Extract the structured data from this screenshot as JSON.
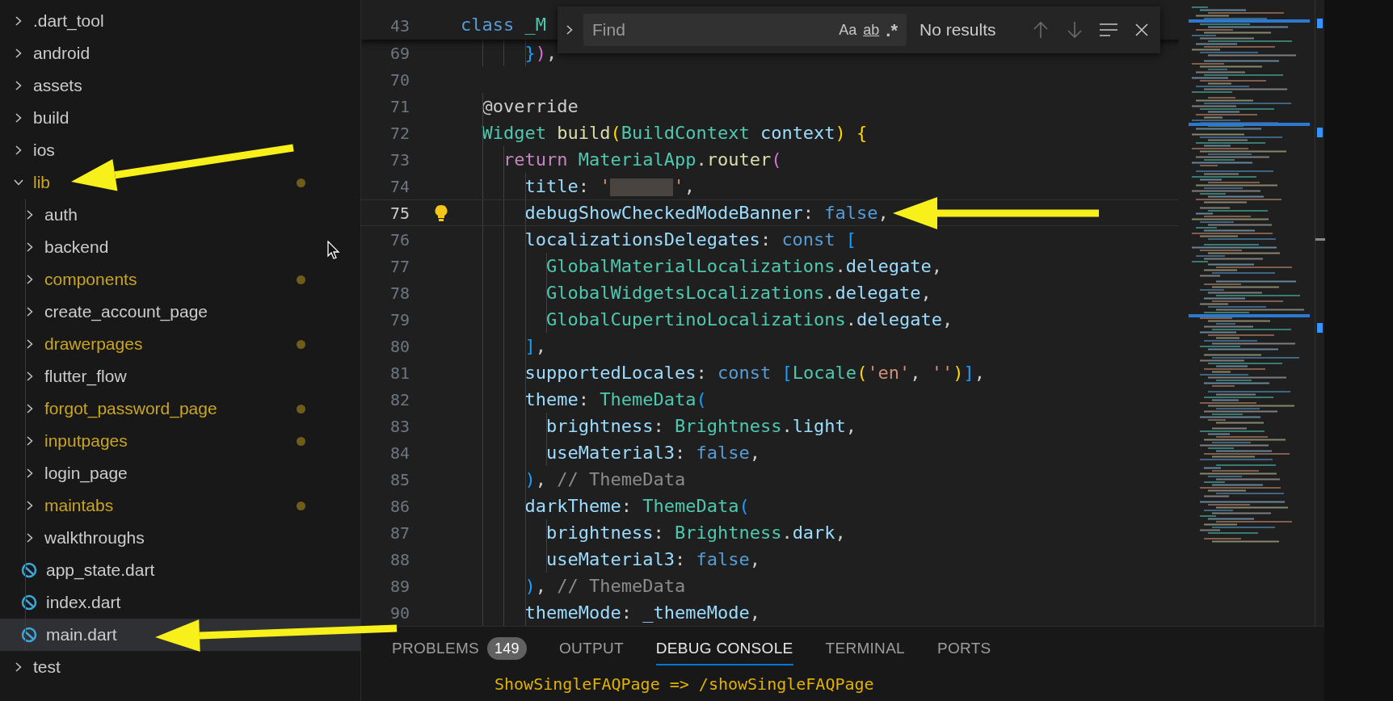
{
  "explorer": {
    "items": [
      {
        "label": ".dart_tool",
        "kind": "folder",
        "expanded": false,
        "modified": false,
        "selected": false
      },
      {
        "label": "android",
        "kind": "folder",
        "expanded": false,
        "modified": false,
        "selected": false
      },
      {
        "label": "assets",
        "kind": "folder",
        "expanded": false,
        "modified": false,
        "selected": false
      },
      {
        "label": "build",
        "kind": "folder",
        "expanded": false,
        "modified": false,
        "selected": false
      },
      {
        "label": "ios",
        "kind": "folder",
        "expanded": false,
        "modified": false,
        "selected": false
      },
      {
        "label": "lib",
        "kind": "folder",
        "expanded": true,
        "modified": true,
        "selected": false,
        "children": [
          {
            "label": "auth",
            "kind": "folder",
            "expanded": false,
            "modified": false,
            "selected": false
          },
          {
            "label": "backend",
            "kind": "folder",
            "expanded": false,
            "modified": false,
            "selected": false
          },
          {
            "label": "components",
            "kind": "folder",
            "expanded": false,
            "modified": true,
            "selected": false
          },
          {
            "label": "create_account_page",
            "kind": "folder",
            "expanded": false,
            "modified": false,
            "selected": false
          },
          {
            "label": "drawerpages",
            "kind": "folder",
            "expanded": false,
            "modified": true,
            "selected": false
          },
          {
            "label": "flutter_flow",
            "kind": "folder",
            "expanded": false,
            "modified": false,
            "selected": false
          },
          {
            "label": "forgot_password_page",
            "kind": "folder",
            "expanded": false,
            "modified": true,
            "selected": false
          },
          {
            "label": "inputpages",
            "kind": "folder",
            "expanded": false,
            "modified": true,
            "selected": false
          },
          {
            "label": "login_page",
            "kind": "folder",
            "expanded": false,
            "modified": false,
            "selected": false
          },
          {
            "label": "maintabs",
            "kind": "folder",
            "expanded": false,
            "modified": true,
            "selected": false
          },
          {
            "label": "walkthroughs",
            "kind": "folder",
            "expanded": false,
            "modified": false,
            "selected": false
          },
          {
            "label": "app_state.dart",
            "kind": "file",
            "modified": false,
            "selected": false
          },
          {
            "label": "index.dart",
            "kind": "file",
            "modified": false,
            "selected": false
          },
          {
            "label": "main.dart",
            "kind": "file",
            "modified": false,
            "selected": true
          }
        ]
      },
      {
        "label": "test",
        "kind": "folder",
        "expanded": false,
        "modified": false,
        "selected": false
      }
    ]
  },
  "editor": {
    "sticky_line": {
      "number": "43",
      "tokens": [
        {
          "kind": "kw",
          "text": "class "
        },
        {
          "kind": "type",
          "text": "_M"
        }
      ]
    },
    "lines": [
      {
        "number": "69",
        "current": false,
        "lightbulb": false,
        "tokens": [
          {
            "kind": "b3",
            "text": "      }"
          },
          {
            "kind": "b2",
            "text": ")"
          },
          {
            "kind": "plain",
            "text": ","
          }
        ]
      },
      {
        "number": "70",
        "current": false,
        "lightbulb": false
      },
      {
        "number": "71",
        "current": false,
        "lightbulb": false,
        "tokens": [
          {
            "kind": "plain",
            "text": "  @override"
          }
        ]
      },
      {
        "number": "72",
        "current": false,
        "lightbulb": false,
        "tokens": [
          {
            "kind": "type",
            "text": "  Widget "
          },
          {
            "kind": "fn",
            "text": "build"
          },
          {
            "kind": "b1",
            "text": "("
          },
          {
            "kind": "type",
            "text": "BuildContext "
          },
          {
            "kind": "prop",
            "text": "context"
          },
          {
            "kind": "b1",
            "text": ") "
          },
          {
            "kind": "b1",
            "text": "{"
          }
        ]
      },
      {
        "number": "73",
        "current": false,
        "lightbulb": false,
        "tokens": [
          {
            "kind": "ctl",
            "text": "    return "
          },
          {
            "kind": "type",
            "text": "MaterialApp"
          },
          {
            "kind": "plain",
            "text": "."
          },
          {
            "kind": "fn",
            "text": "router"
          },
          {
            "kind": "b2",
            "text": "("
          }
        ]
      },
      {
        "number": "74",
        "current": false,
        "lightbulb": false,
        "tokens": [
          {
            "kind": "prop",
            "text": "      title"
          },
          {
            "kind": "plain",
            "text": ": "
          },
          {
            "kind": "str",
            "text": "'"
          },
          {
            "kind": "redacted"
          },
          {
            "kind": "str",
            "text": "'"
          },
          {
            "kind": "plain",
            "text": ","
          }
        ]
      },
      {
        "number": "75",
        "current": true,
        "lightbulb": true,
        "tokens": [
          {
            "kind": "prop",
            "text": "      debugShowCheckedModeBanner"
          },
          {
            "kind": "plain",
            "text": ": "
          },
          {
            "kind": "kw",
            "text": "false"
          },
          {
            "kind": "plain",
            "text": ","
          }
        ]
      },
      {
        "number": "76",
        "current": false,
        "lightbulb": false,
        "tokens": [
          {
            "kind": "prop",
            "text": "      localizationsDelegates"
          },
          {
            "kind": "plain",
            "text": ": "
          },
          {
            "kind": "kw",
            "text": "const "
          },
          {
            "kind": "b3",
            "text": "["
          }
        ]
      },
      {
        "number": "77",
        "current": false,
        "lightbulb": false,
        "tokens": [
          {
            "kind": "type",
            "text": "        GlobalMaterialLocalizations"
          },
          {
            "kind": "plain",
            "text": "."
          },
          {
            "kind": "prop",
            "text": "delegate"
          },
          {
            "kind": "plain",
            "text": ","
          }
        ]
      },
      {
        "number": "78",
        "current": false,
        "lightbulb": false,
        "tokens": [
          {
            "kind": "type",
            "text": "        GlobalWidgetsLocalizations"
          },
          {
            "kind": "plain",
            "text": "."
          },
          {
            "kind": "prop",
            "text": "delegate"
          },
          {
            "kind": "plain",
            "text": ","
          }
        ]
      },
      {
        "number": "79",
        "current": false,
        "lightbulb": false,
        "tokens": [
          {
            "kind": "type",
            "text": "        GlobalCupertinoLocalizations"
          },
          {
            "kind": "plain",
            "text": "."
          },
          {
            "kind": "prop",
            "text": "delegate"
          },
          {
            "kind": "plain",
            "text": ","
          }
        ]
      },
      {
        "number": "80",
        "current": false,
        "lightbulb": false,
        "tokens": [
          {
            "kind": "b3",
            "text": "      ]"
          },
          {
            "kind": "plain",
            "text": ","
          }
        ]
      },
      {
        "number": "81",
        "current": false,
        "lightbulb": false,
        "tokens": [
          {
            "kind": "prop",
            "text": "      supportedLocales"
          },
          {
            "kind": "plain",
            "text": ": "
          },
          {
            "kind": "kw",
            "text": "const "
          },
          {
            "kind": "b3",
            "text": "["
          },
          {
            "kind": "type",
            "text": "Locale"
          },
          {
            "kind": "b1",
            "text": "("
          },
          {
            "kind": "str",
            "text": "'en'"
          },
          {
            "kind": "plain",
            "text": ", "
          },
          {
            "kind": "str",
            "text": "''"
          },
          {
            "kind": "b1",
            "text": ")"
          },
          {
            "kind": "b3",
            "text": "]"
          },
          {
            "kind": "plain",
            "text": ","
          }
        ]
      },
      {
        "number": "82",
        "current": false,
        "lightbulb": false,
        "tokens": [
          {
            "kind": "prop",
            "text": "      theme"
          },
          {
            "kind": "plain",
            "text": ": "
          },
          {
            "kind": "type",
            "text": "ThemeData"
          },
          {
            "kind": "b3",
            "text": "("
          }
        ]
      },
      {
        "number": "83",
        "current": false,
        "lightbulb": false,
        "tokens": [
          {
            "kind": "prop",
            "text": "        brightness"
          },
          {
            "kind": "plain",
            "text": ": "
          },
          {
            "kind": "type",
            "text": "Brightness"
          },
          {
            "kind": "plain",
            "text": "."
          },
          {
            "kind": "prop",
            "text": "light"
          },
          {
            "kind": "plain",
            "text": ","
          }
        ]
      },
      {
        "number": "84",
        "current": false,
        "lightbulb": false,
        "tokens": [
          {
            "kind": "prop",
            "text": "        useMaterial3"
          },
          {
            "kind": "plain",
            "text": ": "
          },
          {
            "kind": "kw",
            "text": "false"
          },
          {
            "kind": "plain",
            "text": ","
          }
        ]
      },
      {
        "number": "85",
        "current": false,
        "lightbulb": false,
        "tokens": [
          {
            "kind": "b3",
            "text": "      )"
          },
          {
            "kind": "plain",
            "text": ", "
          },
          {
            "kind": "cmt",
            "text": "// ThemeData"
          }
        ]
      },
      {
        "number": "86",
        "current": false,
        "lightbulb": false,
        "tokens": [
          {
            "kind": "prop",
            "text": "      darkTheme"
          },
          {
            "kind": "plain",
            "text": ": "
          },
          {
            "kind": "type",
            "text": "ThemeData"
          },
          {
            "kind": "b3",
            "text": "("
          }
        ]
      },
      {
        "number": "87",
        "current": false,
        "lightbulb": false,
        "tokens": [
          {
            "kind": "prop",
            "text": "        brightness"
          },
          {
            "kind": "plain",
            "text": ": "
          },
          {
            "kind": "type",
            "text": "Brightness"
          },
          {
            "kind": "plain",
            "text": "."
          },
          {
            "kind": "prop",
            "text": "dark"
          },
          {
            "kind": "plain",
            "text": ","
          }
        ]
      },
      {
        "number": "88",
        "current": false,
        "lightbulb": false,
        "tokens": [
          {
            "kind": "prop",
            "text": "        useMaterial3"
          },
          {
            "kind": "plain",
            "text": ": "
          },
          {
            "kind": "kw",
            "text": "false"
          },
          {
            "kind": "plain",
            "text": ","
          }
        ]
      },
      {
        "number": "89",
        "current": false,
        "lightbulb": false,
        "tokens": [
          {
            "kind": "b3",
            "text": "      )"
          },
          {
            "kind": "plain",
            "text": ", "
          },
          {
            "kind": "cmt",
            "text": "// ThemeData"
          }
        ]
      },
      {
        "number": "90",
        "current": false,
        "lightbulb": false,
        "tokens": [
          {
            "kind": "prop",
            "text": "      themeMode"
          },
          {
            "kind": "plain",
            "text": ": "
          },
          {
            "kind": "prop",
            "text": "_themeMode"
          },
          {
            "kind": "plain",
            "text": ","
          }
        ]
      }
    ]
  },
  "find_widget": {
    "placeholder": "Find",
    "options": [
      "Aa",
      "ab",
      ".*"
    ],
    "status": "No results"
  },
  "panel": {
    "tabs": [
      {
        "label": "PROBLEMS",
        "badge": "149",
        "selected": false
      },
      {
        "label": "OUTPUT",
        "selected": false
      },
      {
        "label": "DEBUG CONSOLE",
        "selected": true
      },
      {
        "label": "TERMINAL",
        "selected": false
      },
      {
        "label": "PORTS",
        "selected": false
      }
    ],
    "console_line": "ShowSingleFAQPage => /showSingleFAQPage"
  },
  "annotations": [
    {
      "kind": "arrow"
    },
    {
      "kind": "arrow"
    },
    {
      "kind": "arrow"
    }
  ]
}
